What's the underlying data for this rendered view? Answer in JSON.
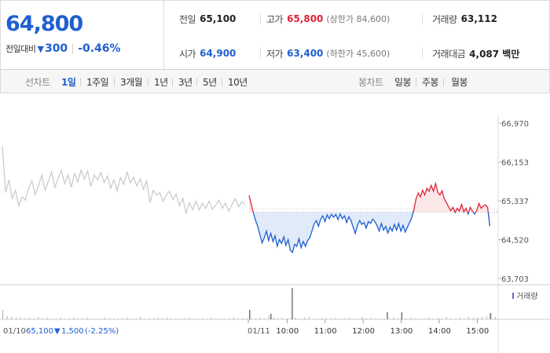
{
  "summary": {
    "current_price": "64,800",
    "change_label": "전일대비",
    "change_arrow": "▼",
    "change_amount": "300",
    "change_rate": "-0.46%",
    "prev_close_label": "전일",
    "prev_close": "65,100",
    "open_label": "시가",
    "open": "64,900",
    "high_label": "고가",
    "high": "65,800",
    "upper_limit": "(상한가 84,600)",
    "low_label": "저가",
    "low": "63,400",
    "lower_limit": "(하한가 45,600)",
    "volume_label": "거래량",
    "volume": "63,112",
    "value_label": "거래대금",
    "value": "4,087 백만"
  },
  "toolbar": {
    "line_title": "선차트",
    "periods": [
      "1일",
      "1주일",
      "3개월",
      "1년",
      "3년",
      "5년",
      "10년"
    ],
    "active_period": "1일",
    "candle_title": "봉차트",
    "candles": [
      "일봉",
      "주봉",
      "월봉"
    ]
  },
  "colors": {
    "rise": "#e0233a",
    "fall": "#1f5fd0",
    "prev_day_line": "#c8c8c8",
    "rise_fill": "#fbe3e6",
    "fall_fill": "#dde8f7",
    "volume_bar": "#b0b0b0"
  },
  "chart_data": [
    {
      "type": "line",
      "title": "",
      "y_ticks": [
        66970,
        66153,
        65337,
        64520,
        63703
      ],
      "ylim": [
        63703,
        66970
      ],
      "x_ticks": [
        "01/11",
        "10:00",
        "11:00",
        "12:00",
        "13:00",
        "14:00",
        "15:00"
      ],
      "x_hour_ticks": [
        10,
        11,
        12,
        13,
        14,
        15
      ],
      "reference_price": 65100,
      "series": [
        {
          "name": "01/10",
          "style": "previous-day",
          "values": [
            66480,
            65510,
            65780,
            65390,
            65560,
            65230,
            65420,
            65350,
            65600,
            65760,
            65470,
            65650,
            65880,
            65560,
            65740,
            65950,
            65620,
            65810,
            65970,
            65700,
            65880,
            65620,
            65910,
            65730,
            65980,
            65790,
            65960,
            65640,
            65880,
            65780,
            65930,
            65720,
            65860,
            65600,
            65780,
            65550,
            65830,
            65680,
            65940,
            65720,
            65830,
            65650,
            65800,
            65580,
            65760,
            65300,
            65560,
            65460,
            65510,
            65320,
            65460,
            65540,
            65360,
            65480,
            65230,
            65390,
            65080,
            65300,
            65150,
            65330,
            65140,
            65290,
            65170,
            65330,
            65160,
            65240,
            65350,
            65180,
            65290,
            65120,
            65260,
            65380,
            65210,
            65320,
            65260
          ]
        },
        {
          "name": "01/11",
          "style": "today",
          "x_start_hour": 9.0,
          "x_end_hour": 15.33,
          "values": [
            65450,
            65260,
            65080,
            64920,
            64800,
            64620,
            64450,
            64560,
            64700,
            64500,
            64650,
            64480,
            64600,
            64380,
            64520,
            64440,
            64580,
            64400,
            64520,
            64300,
            64250,
            64420,
            64380,
            64540,
            64350,
            64480,
            64380,
            64500,
            64560,
            64700,
            64850,
            64920,
            64800,
            64950,
            65020,
            64900,
            65040,
            64960,
            65050,
            64990,
            65050,
            64940,
            65060,
            64960,
            65020,
            64880,
            65000,
            64920,
            64780,
            64650,
            64820,
            64920,
            64840,
            64880,
            64760,
            64900,
            64860,
            64950,
            64900,
            64820,
            64700,
            64860,
            64720,
            64800,
            64660,
            64780,
            64700,
            64840,
            64720,
            64860,
            64700,
            64820,
            64680,
            64780,
            64880,
            64980,
            65150,
            65380,
            65500,
            65420,
            65560,
            65460,
            65600,
            65540,
            65660,
            65540,
            65700,
            65520,
            65460,
            65550,
            65380,
            65300,
            65210,
            65130,
            65200,
            65090,
            65180,
            65120,
            65260,
            65100,
            65180,
            65060,
            65200,
            65120,
            65060,
            65130,
            65280,
            65180,
            65230,
            65250,
            65200,
            64800
          ]
        }
      ]
    },
    {
      "type": "bar",
      "title": "",
      "legend": [
        "거래량"
      ],
      "series": [
        {
          "name": "거래량",
          "values": [
            12,
            4,
            3,
            2,
            2,
            1,
            2,
            1,
            3,
            1,
            2,
            1,
            1,
            2,
            1,
            1,
            2,
            1,
            1,
            2,
            1,
            1,
            1,
            2,
            1,
            1,
            1,
            1,
            2,
            1,
            1,
            3,
            1,
            1,
            1,
            2,
            1,
            2,
            1,
            1,
            1,
            1,
            2,
            1,
            1,
            1,
            1,
            2,
            1,
            1,
            1,
            1,
            2,
            1,
            1,
            1,
            1,
            1,
            2,
            1,
            5,
            2,
            1,
            2,
            1,
            1,
            2,
            1,
            2,
            3,
            1,
            1,
            2,
            1,
            1,
            2,
            1,
            1,
            2,
            1,
            1,
            3,
            1,
            2,
            1,
            1,
            1,
            1,
            2,
            1,
            1,
            1,
            2,
            1,
            1,
            1,
            2,
            1,
            2,
            1,
            3,
            1,
            1,
            2,
            1,
            3,
            2,
            2,
            3,
            4,
            8,
            3
          ]
        }
      ],
      "spikes": [
        {
          "x_hour": 9.0,
          "value": 12
        },
        {
          "x_hour": 9.56,
          "value": 7
        },
        {
          "x_hour": 10.12,
          "value": 40
        },
        {
          "x_hour": 12.62,
          "value": 9
        },
        {
          "x_hour": 13.0,
          "value": 9
        },
        {
          "x_hour": 15.33,
          "value": 8
        }
      ]
    }
  ],
  "footer": {
    "date": "01/10",
    "close": "65,100",
    "arrow": "▼",
    "change": "1,500",
    "rate": "(-2.25%)"
  }
}
